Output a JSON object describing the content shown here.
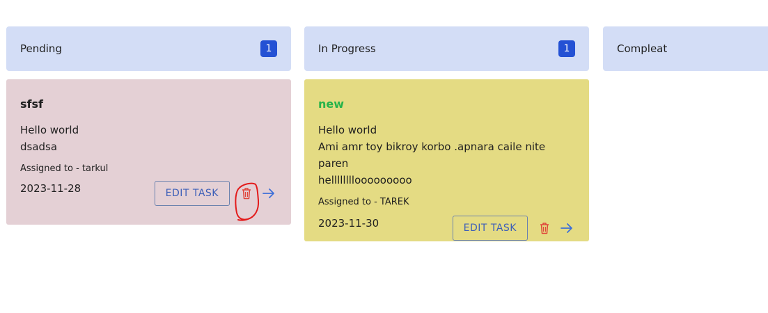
{
  "columns": [
    {
      "title": "Pending",
      "count": "1"
    },
    {
      "title": "In Progress",
      "count": "1"
    },
    {
      "title": "Compleat"
    }
  ],
  "cards": [
    {
      "title": "sfsf",
      "desc_lines": [
        "Hello world",
        "dsadsa"
      ],
      "assigned": "Assigned to - tarkul",
      "date": "2023-11-28",
      "edit_label": "EDIT TASK"
    },
    {
      "title": "new",
      "desc_lines": [
        "Hello world",
        "Ami amr toy bikroy korbo .apnara caile nite paren",
        "hellllllllooooooooo"
      ],
      "assigned": "Assigned to - TAREK",
      "date": "2023-11-30",
      "edit_label": "EDIT TASK"
    }
  ],
  "icons": {
    "delete": "trash-icon",
    "move": "arrow-right-icon"
  },
  "colors": {
    "header_bg": "#d3ddf6",
    "badge": "#2451d4",
    "pending_card": "#e4d0d5",
    "progress_card": "#e4db83",
    "delete_red": "#e0463a",
    "move_blue": "#3d6fd8",
    "title_green": "#27b34a",
    "annotation_red": "#e31b1b"
  }
}
